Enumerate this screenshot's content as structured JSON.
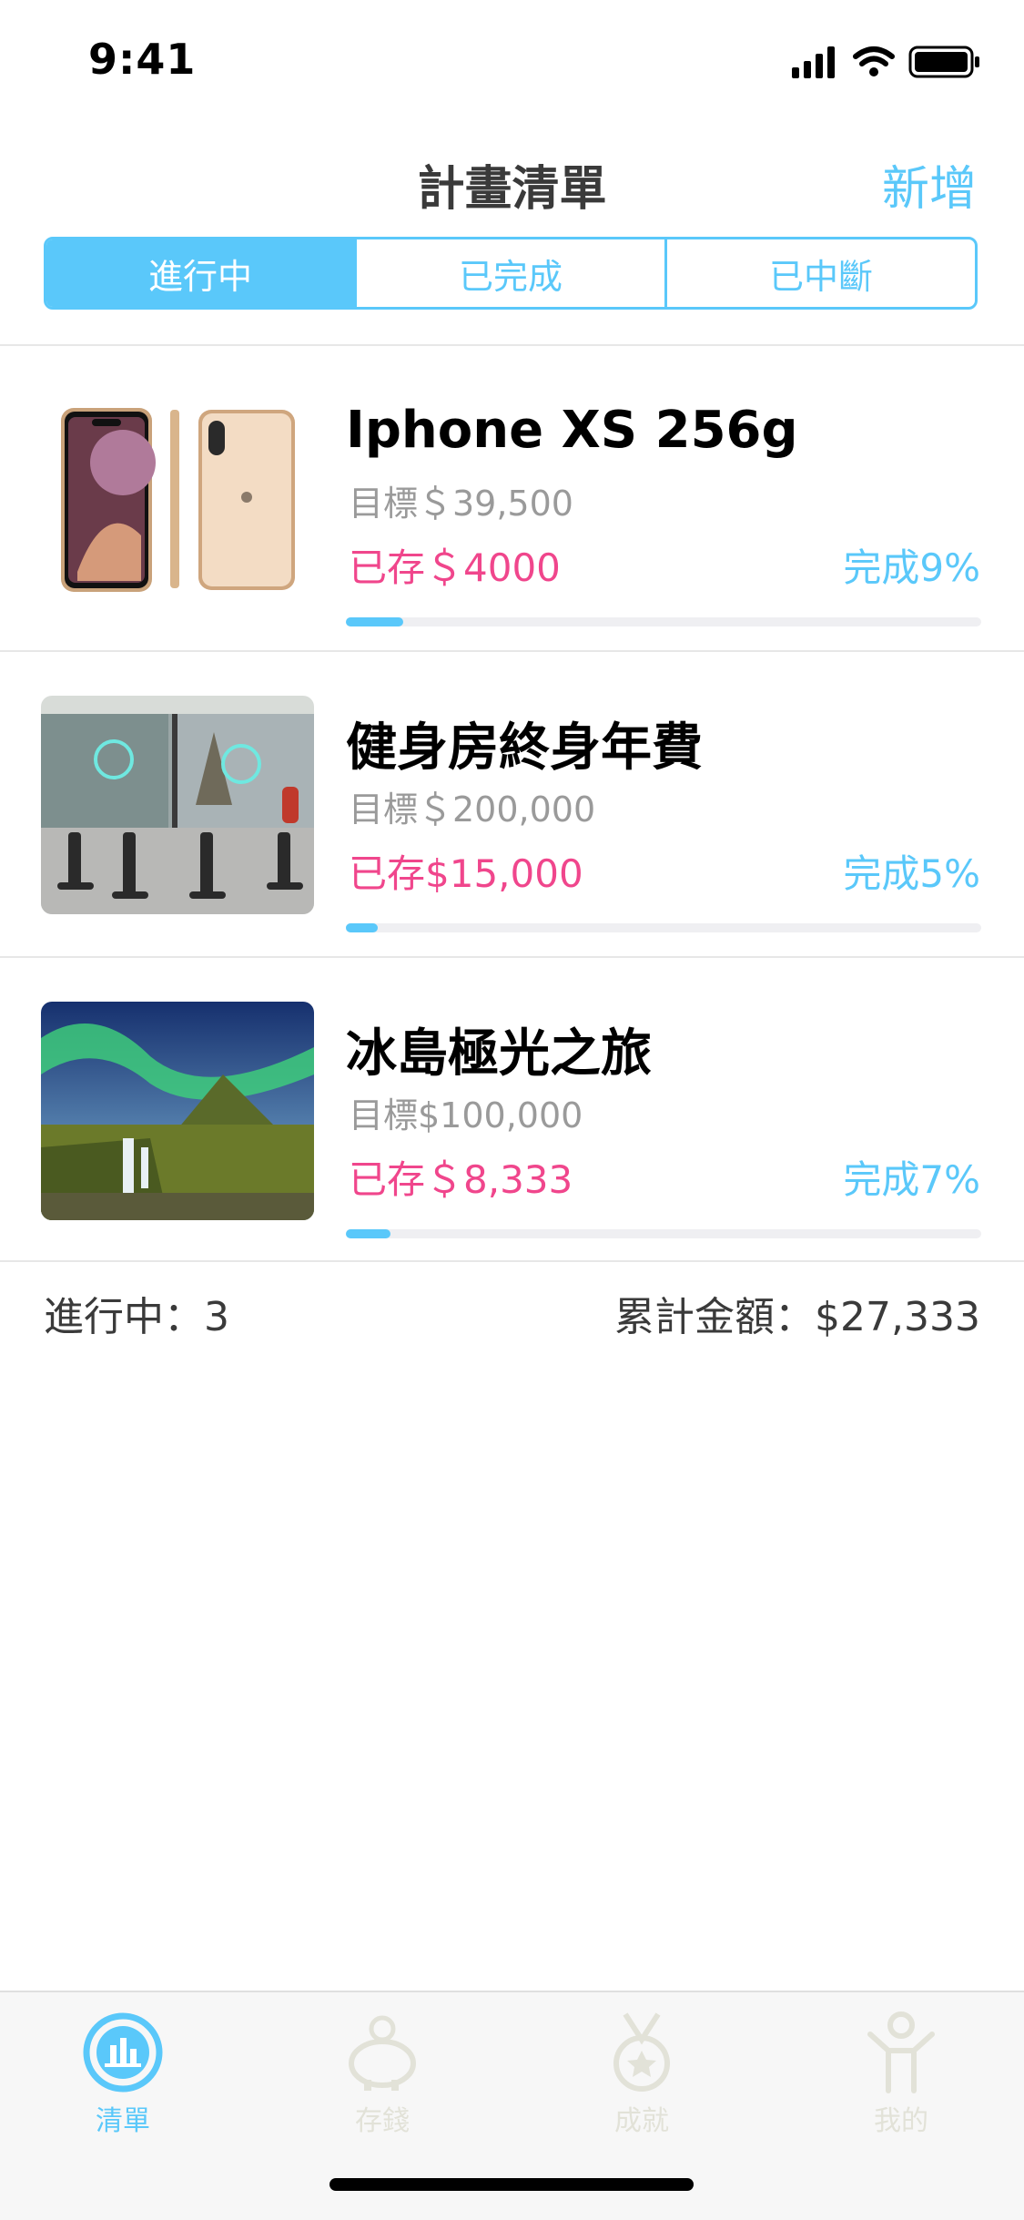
{
  "status_bar": {
    "time": "9:41"
  },
  "nav": {
    "title": "計畫清單",
    "add_label": "新增"
  },
  "segments": [
    {
      "label": "進行中",
      "active": true
    },
    {
      "label": "已完成",
      "active": false
    },
    {
      "label": "已中斷",
      "active": false
    }
  ],
  "items": [
    {
      "title": "Iphone XS 256g",
      "target": "目標＄39,500",
      "saved": "已存＄4000",
      "percent_label": "完成9%",
      "progress": 0.09,
      "image": "iphone-xs-photo"
    },
    {
      "title": "健身房終身年費",
      "target": "目標＄200,000",
      "saved": "已存$15,000",
      "percent_label": "完成5%",
      "progress": 0.05,
      "image": "gym-bikes-photo"
    },
    {
      "title": "冰島極光之旅",
      "target": "目標$100,000",
      "saved": "已存＄8,333",
      "percent_label": "完成7%",
      "progress": 0.07,
      "image": "iceland-aurora-photo"
    }
  ],
  "summary": {
    "active_count": "進行中：3",
    "total_amount": "累計金額：$27,333"
  },
  "tab_bar": {
    "tabs": [
      {
        "label": "清單",
        "icon": "list-chart-icon",
        "active": true
      },
      {
        "label": "存錢",
        "icon": "piggy-bank-icon",
        "active": false
      },
      {
        "label": "成就",
        "icon": "medal-icon",
        "active": false
      },
      {
        "label": "我的",
        "icon": "person-icon",
        "active": false
      }
    ]
  },
  "colors": {
    "accent": "#5ac8fa",
    "saved": "#f0468c",
    "muted": "#9a9a9a",
    "inactive_icon": "#e2e2d8"
  }
}
